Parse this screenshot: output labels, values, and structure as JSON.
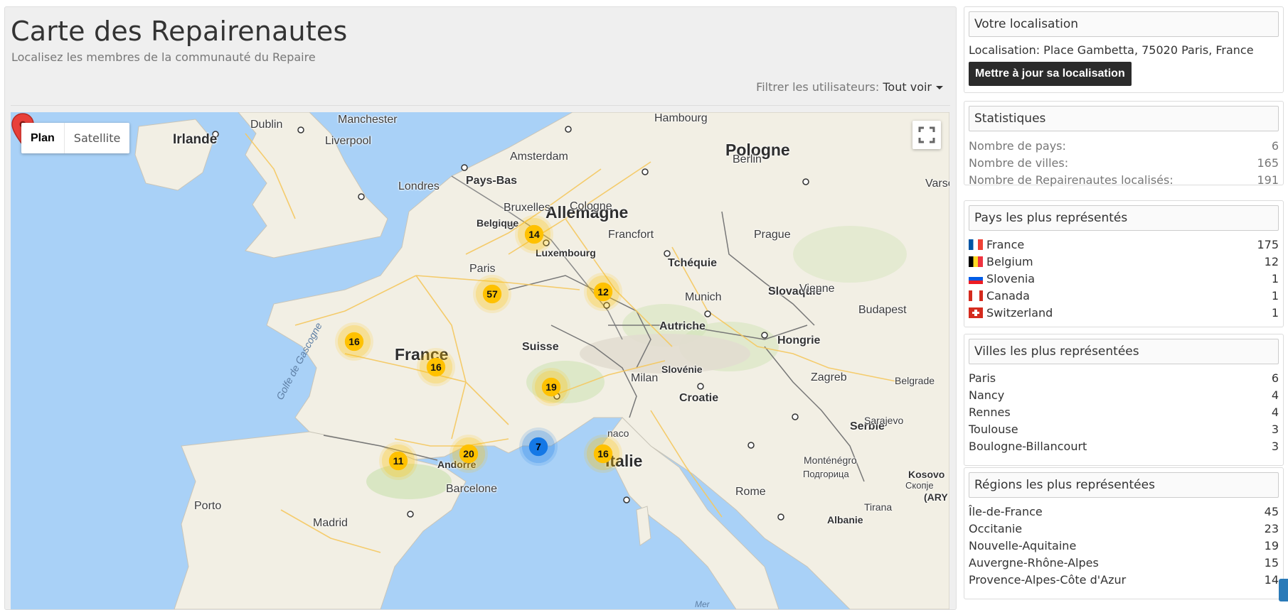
{
  "page": {
    "title": "Carte des Repairenautes",
    "subtitle": "Localisez les membres de la communauté du Repaire",
    "filter_label": "Filtrer les utilisateurs:",
    "filter_value": "Tout voir"
  },
  "map": {
    "type_plan": "Plan",
    "type_satellite": "Satellite",
    "countries": {
      "irlande": "Irlande",
      "pologne": "Pologne",
      "allemagne": "Allemagne",
      "france": "France",
      "pays_bas": "Pays-Bas",
      "tcheque": "Tchéquie",
      "slovaquie": "Slovaquie",
      "autriche": "Autriche",
      "hongrie": "Hongrie",
      "suisse": "Suisse",
      "slovenie": "Slovénie",
      "croatie": "Croatie",
      "italie": "Italie",
      "serbie": "Serbie",
      "andorre": "Andorre",
      "montenegro": "Monténégro",
      "montenegro_cyr": "Подгорица",
      "kosovo": "Kosovo",
      "albanie": "Albanie",
      "luxembourg": "Luxembourg",
      "belgique": "Belgique",
      "ary": "(ARY"
    },
    "cities": {
      "dublin": "Dublin",
      "manchester": "Manchester",
      "liverpool": "Liverpool",
      "londres": "Londres",
      "hambourg": "Hambourg",
      "berlin": "Berlin",
      "amsterdam": "Amsterdam",
      "bruxelles": "Bruxelles",
      "cologne": "Cologne",
      "francfort": "Francfort",
      "prague": "Prague",
      "varsovie": "Varsovi",
      "paris": "Paris",
      "munich": "Munich",
      "vienne": "Vienne",
      "budapest": "Budapest",
      "zagreb": "Zagreb",
      "milan": "Milan",
      "belgrade": "Belgrade",
      "sarajevo": "Sarajevo",
      "rome": "Rome",
      "barcelone": "Barcelone",
      "porto": "Porto",
      "madrid": "Madrid",
      "tirana": "Tirana",
      "monaco": "naco",
      "skopje": "Скопје"
    },
    "seas": {
      "gascogne": "Golfe de Gascogne",
      "mer": "Mer"
    },
    "clusters": [
      {
        "id": "belgique",
        "count": "14",
        "color": "yellow"
      },
      {
        "id": "paris",
        "count": "57",
        "color": "yellow"
      },
      {
        "id": "nancy",
        "count": "12",
        "color": "yellow"
      },
      {
        "id": "rennes",
        "count": "16",
        "color": "yellow"
      },
      {
        "id": "poitiers",
        "count": "16",
        "color": "yellow"
      },
      {
        "id": "lyon",
        "count": "19",
        "color": "yellow"
      },
      {
        "id": "toulouse",
        "count": "20",
        "color": "yellow"
      },
      {
        "id": "bayonne",
        "count": "11",
        "color": "yellow"
      },
      {
        "id": "montpellier",
        "count": "7",
        "color": "blue"
      },
      {
        "id": "nice",
        "count": "16",
        "color": "yellow"
      }
    ]
  },
  "location": {
    "heading": "Votre localisation",
    "text": "Localisation: Place Gambetta, 75020 Paris, France",
    "button": "Mettre à jour sa localisation"
  },
  "stats": {
    "heading": "Statistiques",
    "rows": [
      {
        "label": "Nombre de pays:",
        "value": "6"
      },
      {
        "label": "Nombre de villes:",
        "value": "165"
      },
      {
        "label": "Nombre de Repairenautes localisés:",
        "value": "191"
      }
    ]
  },
  "countries": {
    "heading": "Pays les plus représentés",
    "rows": [
      {
        "name": "France",
        "value": "175",
        "flag": "fr"
      },
      {
        "name": "Belgium",
        "value": "12",
        "flag": "be"
      },
      {
        "name": "Slovenia",
        "value": "1",
        "flag": "si"
      },
      {
        "name": "Canada",
        "value": "1",
        "flag": "ca"
      },
      {
        "name": "Switzerland",
        "value": "1",
        "flag": "ch"
      }
    ]
  },
  "cities": {
    "heading": "Villes les plus représentées",
    "rows": [
      {
        "name": "Paris",
        "value": "6"
      },
      {
        "name": "Nancy",
        "value": "4"
      },
      {
        "name": "Rennes",
        "value": "4"
      },
      {
        "name": "Toulouse",
        "value": "3"
      },
      {
        "name": "Boulogne-Billancourt",
        "value": "3"
      }
    ]
  },
  "regions": {
    "heading": "Régions les plus représentées",
    "rows": [
      {
        "name": "Île-de-France",
        "value": "45"
      },
      {
        "name": "Occitanie",
        "value": "23"
      },
      {
        "name": "Nouvelle-Aquitaine",
        "value": "19"
      },
      {
        "name": "Auvergne-Rhône-Alpes",
        "value": "15"
      },
      {
        "name": "Provence-Alpes-Côte d'Azur",
        "value": "14"
      }
    ]
  },
  "colors": {
    "cluster_yellow": "#ffc100",
    "cluster_blue": "#1478e6",
    "water": "#a9d1f7",
    "land": "#f2efe4",
    "button_bg": "#2b2b2b"
  }
}
